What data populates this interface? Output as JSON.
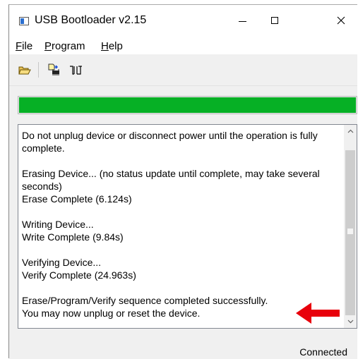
{
  "window": {
    "title": "USB Bootloader v2.15",
    "controls": {
      "minimize": "—",
      "maximize": "☐",
      "close": "✕"
    }
  },
  "menu": {
    "items": [
      {
        "label": "File",
        "mnemonic": "F",
        "rest": "ile"
      },
      {
        "label": "Program",
        "mnemonic": "P",
        "rest": "rogram"
      },
      {
        "label": "Help",
        "mnemonic": "H",
        "rest": "elp"
      }
    ]
  },
  "toolbar": {
    "buttons": [
      {
        "icon": "open-folder-icon"
      },
      {
        "icon": "program-device-icon"
      },
      {
        "icon": "reset-device-icon"
      }
    ]
  },
  "progress": {
    "value": 1.0,
    "color": "#06b025"
  },
  "log": {
    "lines": [
      "Do not unplug device or disconnect power until the operation is fully complete.",
      "",
      "Erasing Device... (no status update until complete, may take several seconds)",
      "Erase Complete (6.124s)",
      "",
      "Writing Device...",
      "Write Complete (9.84s)",
      "",
      "Verifying Device...",
      "Verify Complete (24.963s)",
      "",
      "Erase/Program/Verify sequence completed successfully.",
      "You may now unplug or reset the device."
    ]
  },
  "annotation": {
    "color": "#e8000b"
  },
  "status": {
    "text": "Connected"
  }
}
